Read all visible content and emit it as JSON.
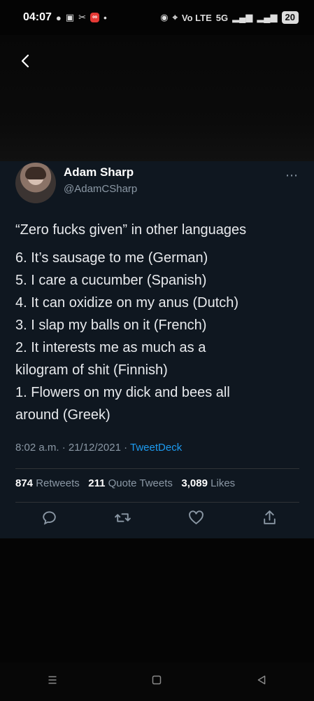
{
  "status_bar": {
    "time": "04:07",
    "icons_left": [
      "chat-icon",
      "car-icon",
      "scissors-icon",
      "notification-badge",
      "dot"
    ],
    "icons_right": [
      "alarm-icon",
      "location-icon",
      "volte-icon",
      "signal-icon",
      "signal-icon",
      "battery"
    ],
    "battery_level": "20",
    "volte_label": "Vo LTE",
    "network_label": "5G"
  },
  "tweet": {
    "author_name": "Adam Sharp",
    "author_handle": "@AdamCSharp",
    "lines": [
      "“Zero fucks given” in other languages",
      "6. It’s sausage to me (German)",
      "5. I care a cucumber (Spanish)",
      "4. It can oxidize on my anus (Dutch)",
      "3. I slap my balls on it (French)",
      "2. It interests me as much as a",
      "kilogram of shit (Finnish)",
      "1. Flowers on my dick and bees all",
      "around (Greek)"
    ],
    "timestamp": "8:02 a.m. · 21/12/2021 · ",
    "source": "TweetDeck",
    "retweets": "874",
    "retweets_label": "Retweets",
    "quote_tweets": "211",
    "quote_tweets_label": "Quote Tweets",
    "likes": "3,089",
    "likes_label": "Likes",
    "actions": [
      "reply-icon",
      "retweet-icon",
      "like-icon",
      "share-icon"
    ]
  },
  "theme": {
    "background": "#050505",
    "card": "#0f1720",
    "accent": "#1d9bf0",
    "muted_text": "#8b98a5"
  }
}
